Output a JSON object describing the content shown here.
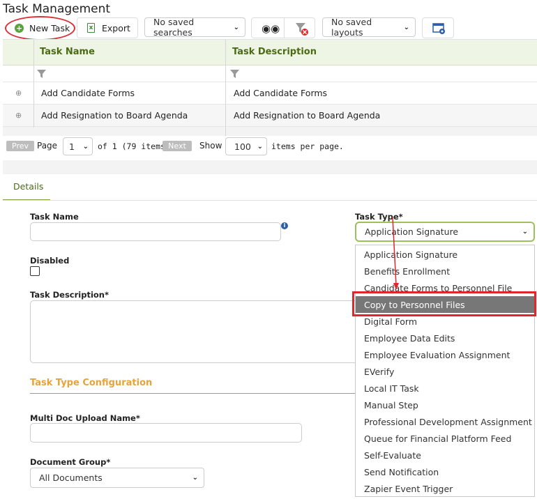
{
  "page_title": "Task Management",
  "toolbar": {
    "new_task_label": "New Task",
    "export_label": "Export",
    "saved_searches_value": "No saved searches",
    "saved_layouts_value": "No saved layouts"
  },
  "grid": {
    "columns": [
      "Task Name",
      "Task Description"
    ],
    "rows": [
      {
        "name": "Add Candidate Forms",
        "description": "Add Candidate Forms"
      },
      {
        "name": "Add Resignation to Board Agenda",
        "description": "Add Resignation to Board Agenda"
      }
    ]
  },
  "pager": {
    "prev_label": "Prev",
    "page_label": "Page",
    "page_value": "1",
    "of_text": "of 1 (79 items)",
    "next_label": "Next",
    "show_label": "Show",
    "per_page_value": "100",
    "per_page_suffix": "items per page."
  },
  "details": {
    "tab_label": "Details",
    "task_name_label": "Task Name",
    "task_type_label": "Task Type*",
    "task_type_value": "Application Signature",
    "disabled_label": "Disabled",
    "task_description_label": "Task Description*",
    "section_title": "Task Type Configuration",
    "multi_doc_label": "Multi Doc Upload Name*",
    "document_group_label": "Document Group*",
    "document_group_value": "All Documents"
  },
  "task_type_options": [
    "Application Signature",
    "Benefits Enrollment",
    "Candidate Forms to Personnel File",
    "Copy to Personnel Files",
    "Digital Form",
    "Employee Data Edits",
    "Employee Evaluation Assignment",
    "EVerify",
    "Local IT Task",
    "Manual Step",
    "Professional Development Assignment",
    "Queue for Financial Platform Feed",
    "Self-Evaluate",
    "Send Notification",
    "Zapier Event Trigger"
  ],
  "highlighted_option": "Copy to Personnel Files",
  "colors": {
    "accent_green": "#4a6b14",
    "section_orange": "#e8a23a",
    "annotation_red": "#e0262a",
    "selected_option_bg": "#777777"
  }
}
